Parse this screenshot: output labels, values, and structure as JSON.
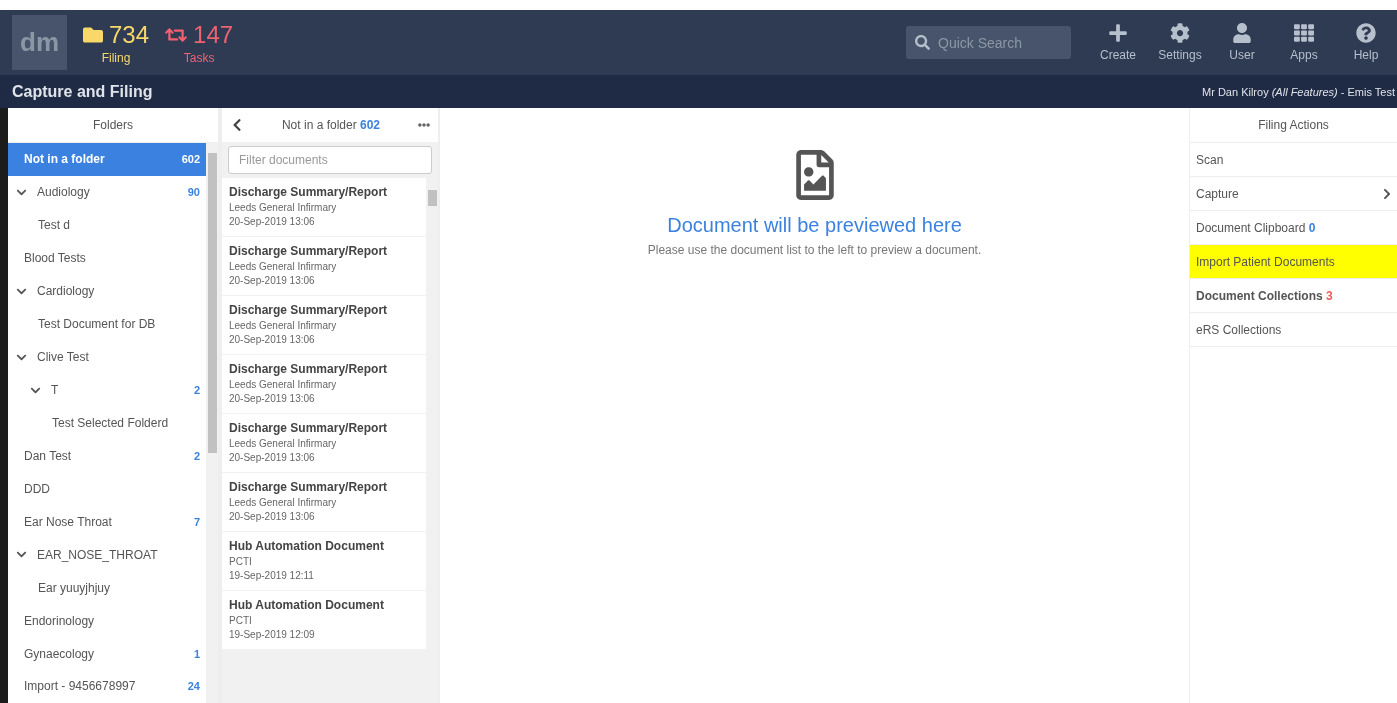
{
  "header": {
    "logo": "dm",
    "counters": [
      {
        "kind": "filing",
        "value": "734",
        "label": "Filing"
      },
      {
        "kind": "tasks",
        "value": "147",
        "label": "Tasks"
      }
    ],
    "search": {
      "placeholder": "Quick Search"
    },
    "nav": [
      {
        "kind": "create",
        "label": "Create"
      },
      {
        "kind": "settings",
        "label": "Settings"
      },
      {
        "kind": "user",
        "label": "User"
      },
      {
        "kind": "apps",
        "label": "Apps"
      },
      {
        "kind": "help",
        "label": "Help"
      }
    ]
  },
  "subheader": {
    "title": "Capture and Filing",
    "user_name": "Mr Dan Kilroy",
    "user_role": "(All Features)",
    "user_org": "- Emis Test"
  },
  "folders": {
    "title": "Folders",
    "items": [
      {
        "label": "Not in a folder",
        "count": "602",
        "selected": true
      },
      {
        "label": "Audiology",
        "count": "90",
        "selected": false,
        "expanded": true,
        "children": [
          {
            "label": "Test d",
            "selected": false
          }
        ]
      },
      {
        "label": "Blood Tests",
        "selected": false
      },
      {
        "label": "Cardiology",
        "selected": false,
        "expanded": true,
        "children": [
          {
            "label": "Test Document for DB",
            "selected": false
          }
        ]
      },
      {
        "label": "Clive Test",
        "selected": false,
        "expanded": true,
        "children": [
          {
            "label": "T",
            "count": "2",
            "selected": false,
            "expanded": true,
            "children": [
              {
                "label": "Test Selected Folderd",
                "selected": false
              }
            ]
          }
        ]
      },
      {
        "label": "Dan Test",
        "count": "2",
        "selected": false
      },
      {
        "label": "DDD",
        "selected": false
      },
      {
        "label": "Ear Nose Throat",
        "count": "7",
        "selected": false
      },
      {
        "label": "EAR_NOSE_THROAT",
        "selected": false,
        "expanded": true,
        "children": [
          {
            "label": "Ear yuuyjhjuy",
            "selected": false
          }
        ]
      },
      {
        "label": "Endorinology",
        "selected": false
      },
      {
        "label": "Gynaecology",
        "count": "1",
        "selected": false
      },
      {
        "label": "Import - 9456678997",
        "count": "24",
        "selected": false
      }
    ]
  },
  "documents": {
    "title": "Not in a folder",
    "count": "602",
    "filter_placeholder": "Filter documents",
    "items": [
      {
        "title": "Discharge Summary/Report",
        "source": "Leeds General Infirmary",
        "date": "20-Sep-2019 13:06"
      },
      {
        "title": "Discharge Summary/Report",
        "source": "Leeds General Infirmary",
        "date": "20-Sep-2019 13:06"
      },
      {
        "title": "Discharge Summary/Report",
        "source": "Leeds General Infirmary",
        "date": "20-Sep-2019 13:06"
      },
      {
        "title": "Discharge Summary/Report",
        "source": "Leeds General Infirmary",
        "date": "20-Sep-2019 13:06"
      },
      {
        "title": "Discharge Summary/Report",
        "source": "Leeds General Infirmary",
        "date": "20-Sep-2019 13:06"
      },
      {
        "title": "Discharge Summary/Report",
        "source": "Leeds General Infirmary",
        "date": "20-Sep-2019 13:06"
      },
      {
        "title": "Hub Automation Document",
        "source": "PCTI",
        "date": "19-Sep-2019 12:11"
      },
      {
        "title": "Hub Automation Document",
        "source": "PCTI",
        "date": "19-Sep-2019 12:09"
      }
    ]
  },
  "preview": {
    "title": "Document will be previewed here",
    "hint": "Please use the document list to the left to preview a document."
  },
  "actions": {
    "title": "Filing Actions",
    "items": [
      {
        "label": "Scan",
        "bold": false,
        "highlighted": false
      },
      {
        "label": "Capture",
        "bold": false,
        "highlighted": false,
        "submenu": true
      },
      {
        "label": "Document Clipboard",
        "count": "0",
        "color": "#3b82e0",
        "bold": false,
        "highlighted": false
      },
      {
        "label": "Import Patient Documents",
        "bold": false,
        "highlighted": true
      },
      {
        "label": "Document Collections",
        "count": "3",
        "color": "#f05a5a",
        "bold": true,
        "highlighted": false
      },
      {
        "label": "eRS Collections",
        "bold": false,
        "highlighted": false
      }
    ]
  }
}
